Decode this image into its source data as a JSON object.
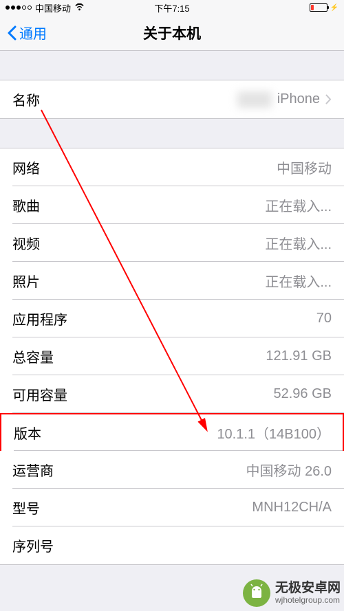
{
  "statusBar": {
    "carrier": "中国移动",
    "time": "下午7:15"
  },
  "nav": {
    "back": "通用",
    "title": "关于本机"
  },
  "group1": {
    "name": {
      "label": "名称",
      "value": "iPhone"
    }
  },
  "group2": {
    "rows": [
      {
        "label": "网络",
        "value": "中国移动"
      },
      {
        "label": "歌曲",
        "value": "正在载入..."
      },
      {
        "label": "视频",
        "value": "正在载入..."
      },
      {
        "label": "照片",
        "value": "正在载入..."
      },
      {
        "label": "应用程序",
        "value": "70"
      },
      {
        "label": "总容量",
        "value": "121.91 GB"
      },
      {
        "label": "可用容量",
        "value": "52.96 GB"
      },
      {
        "label": "版本",
        "value": "10.1.1（14B100）"
      },
      {
        "label": "运营商",
        "value": "中国移动 26.0"
      },
      {
        "label": "型号",
        "value": "MNH12CH/A"
      },
      {
        "label": "序列号",
        "value": ""
      }
    ]
  },
  "watermark": {
    "title": "无极安卓网",
    "url": "wjhotelgroup.com"
  }
}
